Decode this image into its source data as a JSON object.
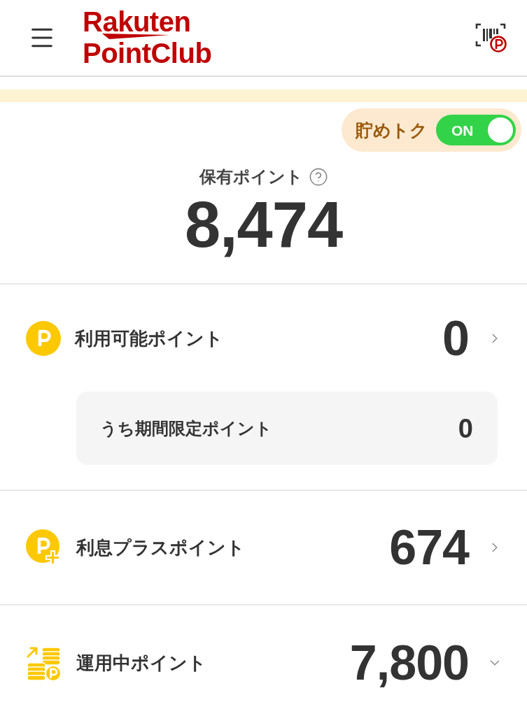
{
  "header": {
    "logo_line_1": "Rakuten",
    "logo_line_2": "PointClub"
  },
  "savings_toggle": {
    "label": "貯めトク",
    "switch_text": "ON",
    "on": true
  },
  "total_points": {
    "label": "保有ポイント",
    "value": "8,474"
  },
  "rows": [
    {
      "kind": "available",
      "label": "利用可能ポイント",
      "value": "0",
      "expandable": false,
      "detail": {
        "label": "うち期間限定ポイント",
        "value": "0"
      }
    },
    {
      "kind": "interest",
      "label": "利息プラスポイント",
      "value": "674",
      "expandable": false
    },
    {
      "kind": "invested",
      "label": "運用中ポイント",
      "value": "7,800",
      "expandable": true
    }
  ]
}
